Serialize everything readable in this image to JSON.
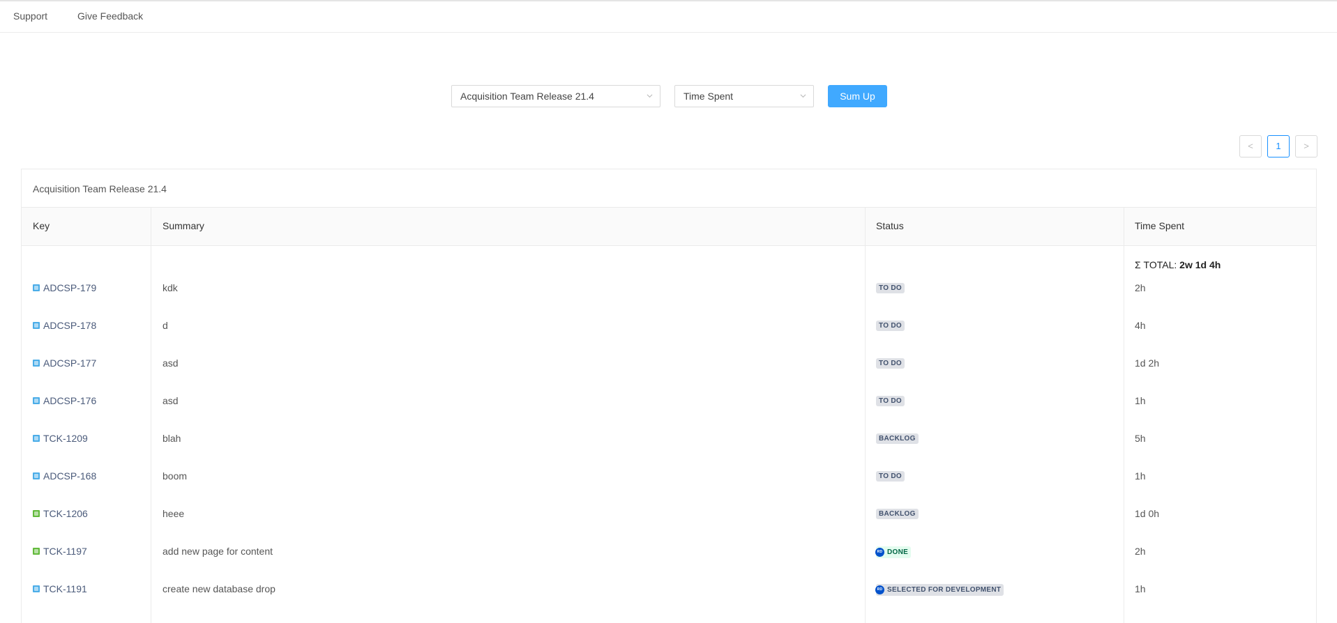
{
  "nav": {
    "support": "Support",
    "feedback": "Give Feedback"
  },
  "controls": {
    "release_select": "Acquisition Team Release 21.4",
    "field_select": "Time Spent",
    "sum_button": "Sum Up"
  },
  "pagination": {
    "prev": "<",
    "current": "1",
    "next": ">"
  },
  "panel": {
    "title": "Acquisition Team Release 21.4",
    "columns": [
      "Key",
      "Summary",
      "Status",
      "Time Spent"
    ],
    "total_label": "Σ TOTAL:",
    "total_value": "2w 1d 4h",
    "rows": [
      {
        "type": "task",
        "key": "ADCSP-179",
        "summary": "kdk",
        "status": "TO DO",
        "status_kind": "todo",
        "avatar": "",
        "time": "2h"
      },
      {
        "type": "task",
        "key": "ADCSP-178",
        "summary": "d",
        "status": "TO DO",
        "status_kind": "todo",
        "avatar": "",
        "time": "4h"
      },
      {
        "type": "task",
        "key": "ADCSP-177",
        "summary": "asd",
        "status": "TO DO",
        "status_kind": "todo",
        "avatar": "",
        "time": "1d 2h"
      },
      {
        "type": "task",
        "key": "ADCSP-176",
        "summary": "asd",
        "status": "TO DO",
        "status_kind": "todo",
        "avatar": "",
        "time": "1h"
      },
      {
        "type": "task",
        "key": "TCK-1209",
        "summary": "blah",
        "status": "BACKLOG",
        "status_kind": "todo",
        "avatar": "",
        "time": "5h"
      },
      {
        "type": "task",
        "key": "ADCSP-168",
        "summary": "boom",
        "status": "TO DO",
        "status_kind": "todo",
        "avatar": "",
        "time": "1h"
      },
      {
        "type": "story",
        "key": "TCK-1206",
        "summary": "heee",
        "status": "BACKLOG",
        "status_kind": "todo",
        "avatar": "",
        "time": "1d 0h"
      },
      {
        "type": "story",
        "key": "TCK-1197",
        "summary": "add new page for content",
        "status": "DONE",
        "status_kind": "done",
        "avatar": "RD",
        "time": "2h"
      },
      {
        "type": "task",
        "key": "TCK-1191",
        "summary": "create new database drop",
        "status": "SELECTED FOR DEVELOPMENT",
        "status_kind": "todo",
        "avatar": "RD",
        "time": "1h"
      }
    ]
  },
  "colors": {
    "accent": "#40a9ff",
    "task_icon": "#4bade8",
    "story_icon": "#63ba3c",
    "done_bg": "#e3fcef",
    "done_fg": "#006644",
    "avatar_bg": "#0052cc"
  }
}
